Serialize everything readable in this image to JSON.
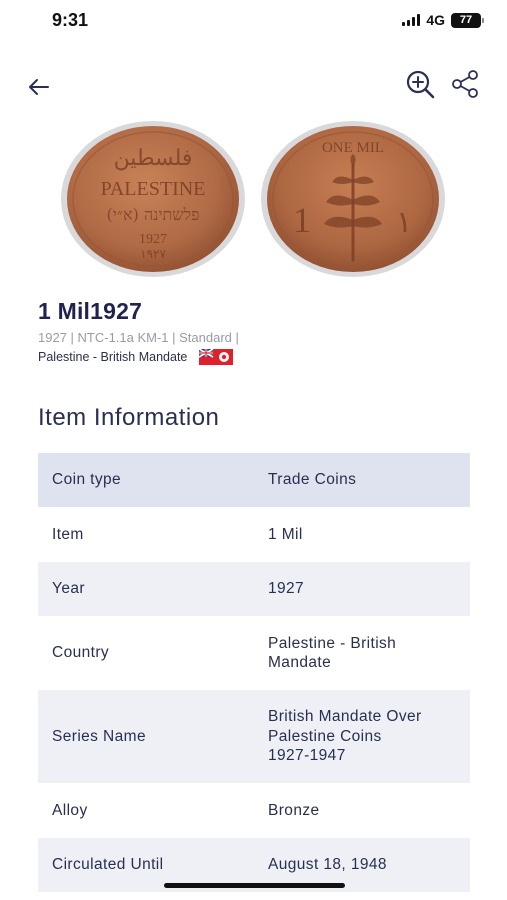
{
  "status": {
    "time": "9:31",
    "network": "4G",
    "battery": "77"
  },
  "nav": {
    "back_icon": "arrow-left-icon",
    "zoom_icon": "zoom-in-icon",
    "share_icon": "share-icon"
  },
  "coin": {
    "title": "1 Mil1927",
    "meta": "1927 | NTC-1.1a  KM-1 | Standard |",
    "country": "Palestine - British Mandate",
    "flag_icon": "british-mandate-palestine-flag-icon",
    "obverse_text": {
      "country": "PALESTINE",
      "year": "1927"
    },
    "reverse_text": {
      "denomination": "1",
      "legend": "ONE MIL"
    }
  },
  "section": {
    "title": "Item Information"
  },
  "info_rows": [
    {
      "label": "Coin type",
      "value": "Trade Coins"
    },
    {
      "label": "Item",
      "value": "1 Mil"
    },
    {
      "label": "Year",
      "value": "1927"
    },
    {
      "label": "Country",
      "value": "Palestine - British\nMandate"
    },
    {
      "label": "Series Name",
      "value": "British Mandate Over\nPalestine Coins\n1927-1947"
    },
    {
      "label": "Alloy",
      "value": "Bronze"
    },
    {
      "label": "Circulated Until",
      "value": "August 18, 1948"
    }
  ],
  "colors": {
    "title": "#1f2350",
    "row_shaded": "#eef0f6",
    "row_header": "#dfe3f0",
    "coin_copper": "#b06a45"
  }
}
